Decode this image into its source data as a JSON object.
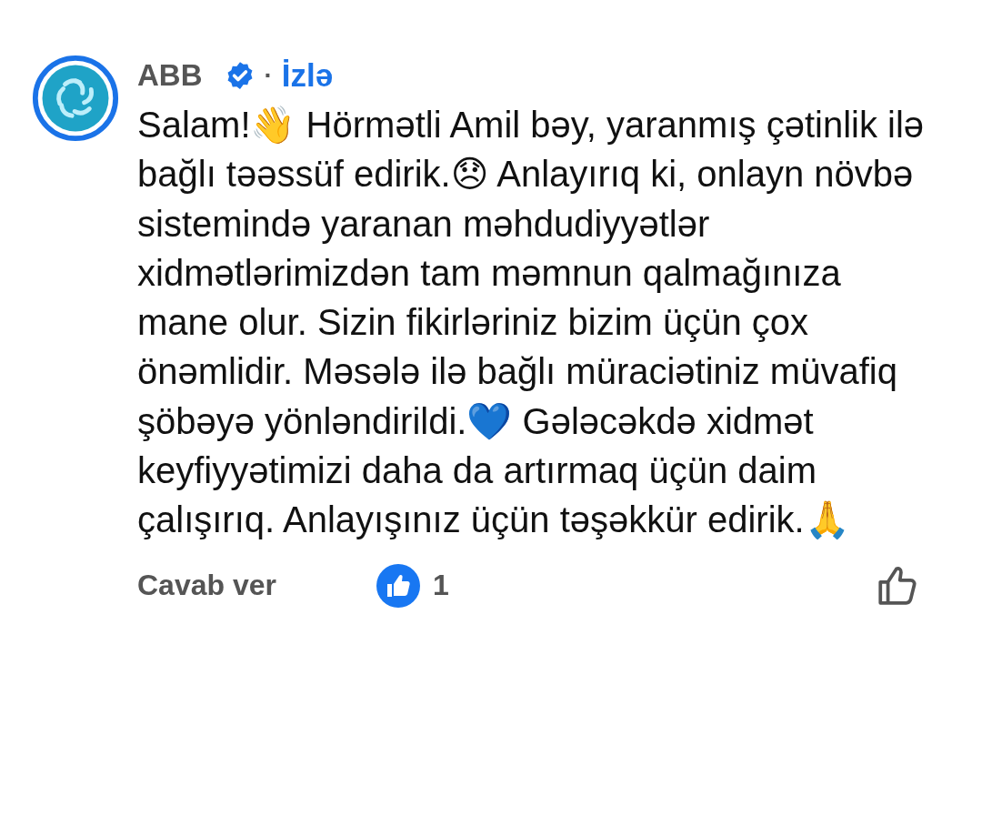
{
  "comment": {
    "author": "ABB",
    "verified": true,
    "separator": "·",
    "follow_label": "İzlə",
    "text": "Salam!👋 Hörmətli Amil bəy, yaranmış çətinlik ilə bağlı təəssüf edirik.😞 Anlayırıq ki, onlayn növbə sistemində yaranan məhdudiyyətlər xidmətlərimizdən tam məmnun qalmağınıza mane olur. Sizin fikirləriniz bizim üçün çox önəmlidir. Məsələ ilə bağlı müraciətiniz müvafiq şöbəyə yönləndirildi.💙 Gələcəkdə xidmət keyfiyyətimizi daha da artırmaq üçün daim çalışırıq. Anlayışınız üçün təşəkkür edirik.🙏",
    "reply_label": "Cavab ver",
    "reaction_count": "1",
    "liked": false
  }
}
